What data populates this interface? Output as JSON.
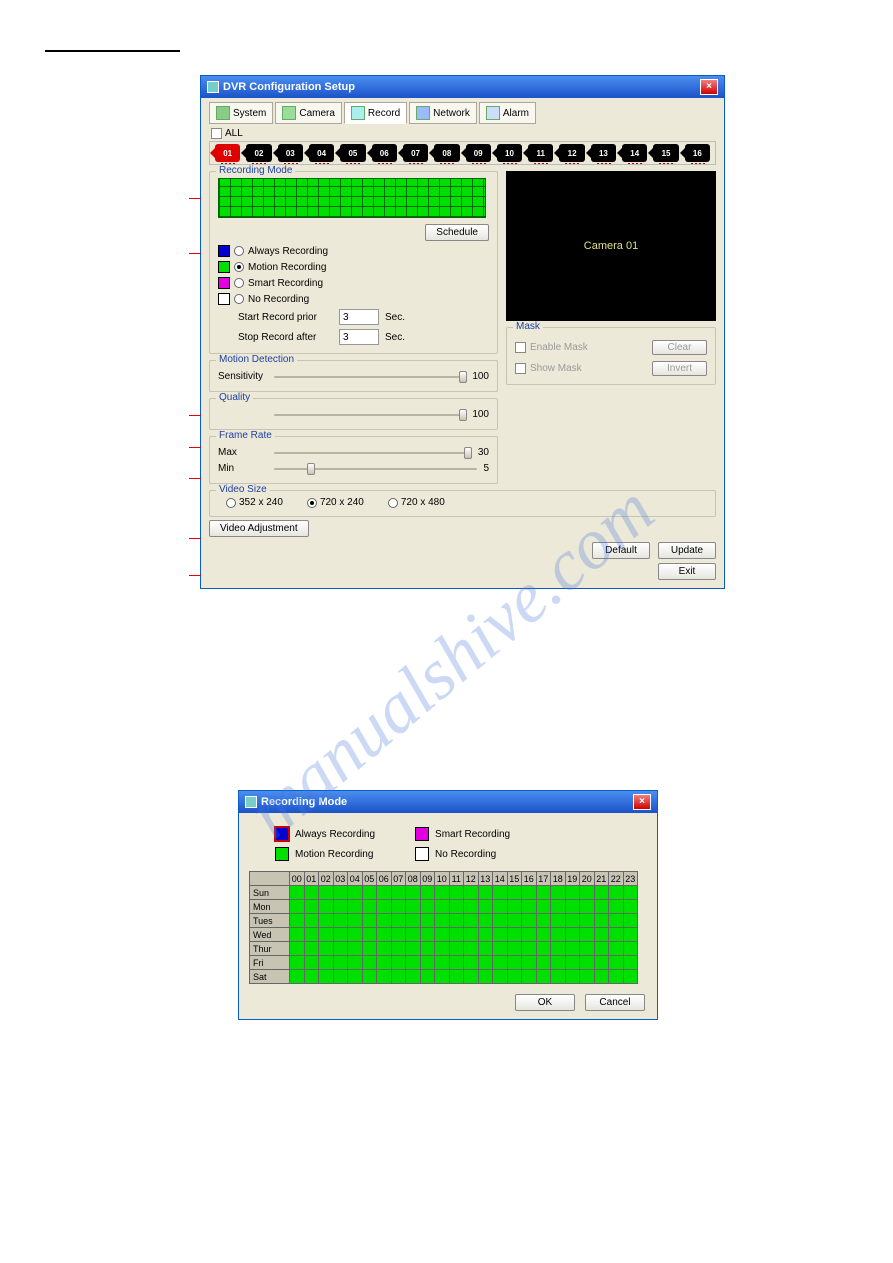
{
  "page_header_underline": true,
  "win1": {
    "title": "DVR Configuration Setup",
    "tabs": {
      "system": "System",
      "camera": "Camera",
      "record": "Record",
      "network": "Network",
      "alarm": "Alarm"
    },
    "all_label": "ALL",
    "camera_labels": [
      "01",
      "02",
      "03",
      "04",
      "05",
      "06",
      "07",
      "08",
      "09",
      "10",
      "11",
      "12",
      "13",
      "14",
      "15",
      "16"
    ],
    "recording_mode": {
      "legend": "Recording Mode",
      "always": "Always Recording",
      "motion": "Motion Recording",
      "smart": "Smart Recording",
      "no": "No Recording",
      "schedule_btn": "Schedule",
      "start_prior_label": "Start Record prior",
      "start_prior_value": "3",
      "stop_after_label": "Stop Record after",
      "stop_after_value": "3",
      "sec": "Sec."
    },
    "motion_detection": {
      "legend": "Motion Detection",
      "sensitivity_label": "Sensitivity",
      "sensitivity_value": "100"
    },
    "quality": {
      "legend": "Quality",
      "value": "100"
    },
    "frame_rate": {
      "legend": "Frame Rate",
      "max_label": "Max",
      "max_value": "30",
      "min_label": "Min",
      "min_value": "5"
    },
    "preview_text": "Camera 01",
    "mask": {
      "legend": "Mask",
      "enable": "Enable Mask",
      "show": "Show Mask",
      "clear": "Clear",
      "invert": "Invert"
    },
    "video_size": {
      "legend": "Video Size",
      "opt1": "352 x 240",
      "opt2": "720 x 240",
      "opt3": "720 x 480"
    },
    "video_adj": "Video Adjustment",
    "default": "Default",
    "update": "Update",
    "exit": "Exit"
  },
  "win2": {
    "title": "Recording Mode",
    "legend": {
      "always": "Always Recording",
      "motion": "Motion Recording",
      "smart": "Smart Recording",
      "no": "No Recording"
    },
    "hours": [
      "00",
      "01",
      "02",
      "03",
      "04",
      "05",
      "06",
      "07",
      "08",
      "09",
      "10",
      "11",
      "12",
      "13",
      "14",
      "15",
      "16",
      "17",
      "18",
      "19",
      "20",
      "21",
      "22",
      "23"
    ],
    "days": [
      "Sun",
      "Mon",
      "Tues",
      "Wed",
      "Thur",
      "Fri",
      "Sat"
    ],
    "ok": "OK",
    "cancel": "Cancel"
  },
  "watermark": "manualshive.com"
}
